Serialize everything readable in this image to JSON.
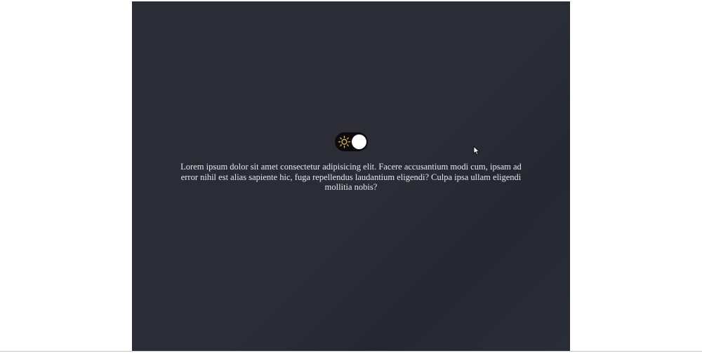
{
  "paragraph": "Lorem ipsum dolor sit amet consectetur adipisicing elit. Facere accusantium modi cum, ipsam ad error nihil est alias sapiente hic, fuga repellendus laudantium eligendi? Culpa ipsa ullam eligendi mollitia nobis?",
  "theme_toggle": {
    "icon": "sun-icon",
    "state": "on"
  },
  "colors": {
    "background": "#2a2d36",
    "toggle_track": "#0b0b0d",
    "sun": "#e2b65a",
    "text": "#e9e9ee"
  }
}
